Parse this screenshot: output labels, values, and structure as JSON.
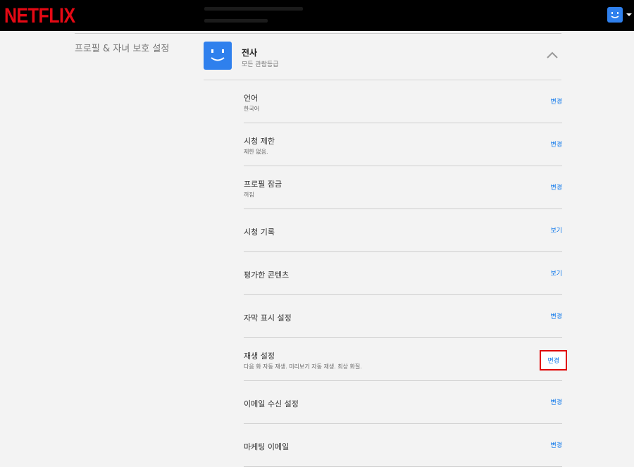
{
  "header": {
    "logo_text": "NETFLIX",
    "brand_color": "#e50914",
    "profile_icon": "smiley-avatar-icon",
    "menu_icon": "caret-down-icon"
  },
  "section": {
    "label": "프로필 & 자녀 보호 설정"
  },
  "profile": {
    "name": "전사",
    "rating": "모든 관람등급",
    "avatar_color": "#2f80ed",
    "collapse_icon": "chevron-up-icon"
  },
  "settings": [
    {
      "title": "언어",
      "description": "한국어",
      "action": "변경"
    },
    {
      "title": "시청 제한",
      "description": "제한 없음.",
      "action": "변경"
    },
    {
      "title": "프로필 잠금",
      "description": "꺼짐",
      "action": "변경"
    },
    {
      "title": "시청 기록",
      "description": "",
      "action": "보기"
    },
    {
      "title": "평가한 콘텐츠",
      "description": "",
      "action": "보기"
    },
    {
      "title": "자막 표시 설정",
      "description": "",
      "action": "변경"
    },
    {
      "title": "재생 설정",
      "description": "다음 화 자동 재생. 미리보기 자동 재생. 최상 화질.",
      "action": "변경",
      "highlighted": true
    },
    {
      "title": "이메일 수신 설정",
      "description": "",
      "action": "변경"
    },
    {
      "title": "마케팅 이메일",
      "description": "",
      "action": "변경"
    }
  ],
  "colors": {
    "link": "#0071eb",
    "highlight_border": "#e00000"
  }
}
